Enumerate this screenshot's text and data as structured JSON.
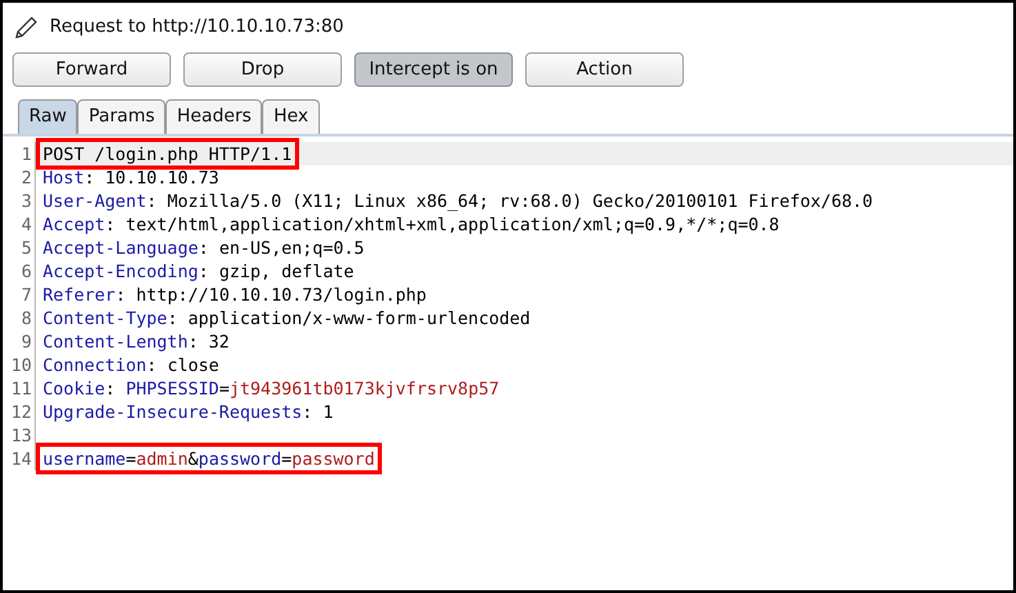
{
  "title": "Request to http://10.10.10.73:80",
  "buttons": [
    {
      "label": "Forward",
      "pressed": false
    },
    {
      "label": "Drop",
      "pressed": false
    },
    {
      "label": "Intercept is on",
      "pressed": true
    },
    {
      "label": "Action",
      "pressed": false
    }
  ],
  "tabs": [
    {
      "label": "Raw",
      "selected": true
    },
    {
      "label": "Params",
      "selected": false
    },
    {
      "label": "Headers",
      "selected": false
    },
    {
      "label": "Hex",
      "selected": false
    }
  ],
  "lines": [
    {
      "number": "1",
      "current": true,
      "highlighted": true,
      "segments": [
        {
          "kind": "plain",
          "text": "POST /login.php HTTP/1.1"
        }
      ]
    },
    {
      "number": "2",
      "current": false,
      "highlighted": false,
      "segments": [
        {
          "kind": "name",
          "text": "Host"
        },
        {
          "kind": "plain",
          "text": ": 10.10.10.73"
        }
      ]
    },
    {
      "number": "3",
      "current": false,
      "highlighted": false,
      "segments": [
        {
          "kind": "name",
          "text": "User-Agent"
        },
        {
          "kind": "plain",
          "text": ": Mozilla/5.0 (X11; Linux x86_64; rv:68.0) Gecko/20100101 Firefox/68.0"
        }
      ]
    },
    {
      "number": "4",
      "current": false,
      "highlighted": false,
      "segments": [
        {
          "kind": "name",
          "text": "Accept"
        },
        {
          "kind": "plain",
          "text": ": text/html,application/xhtml+xml,application/xml;q=0.9,*/*;q=0.8"
        }
      ]
    },
    {
      "number": "5",
      "current": false,
      "highlighted": false,
      "segments": [
        {
          "kind": "name",
          "text": "Accept-Language"
        },
        {
          "kind": "plain",
          "text": ": en-US,en;q=0.5"
        }
      ]
    },
    {
      "number": "6",
      "current": false,
      "highlighted": false,
      "segments": [
        {
          "kind": "name",
          "text": "Accept-Encoding"
        },
        {
          "kind": "plain",
          "text": ": gzip, deflate"
        }
      ]
    },
    {
      "number": "7",
      "current": false,
      "highlighted": false,
      "segments": [
        {
          "kind": "name",
          "text": "Referer"
        },
        {
          "kind": "plain",
          "text": ": http://10.10.10.73/login.php"
        }
      ]
    },
    {
      "number": "8",
      "current": false,
      "highlighted": false,
      "segments": [
        {
          "kind": "name",
          "text": "Content-Type"
        },
        {
          "kind": "plain",
          "text": ": application/x-www-form-urlencoded"
        }
      ]
    },
    {
      "number": "9",
      "current": false,
      "highlighted": false,
      "segments": [
        {
          "kind": "name",
          "text": "Content-Length"
        },
        {
          "kind": "plain",
          "text": ": 32"
        }
      ]
    },
    {
      "number": "10",
      "current": false,
      "highlighted": false,
      "segments": [
        {
          "kind": "name",
          "text": "Connection"
        },
        {
          "kind": "plain",
          "text": ": close"
        }
      ]
    },
    {
      "number": "11",
      "current": false,
      "highlighted": false,
      "segments": [
        {
          "kind": "name",
          "text": "Cookie"
        },
        {
          "kind": "plain",
          "text": ": "
        },
        {
          "kind": "name",
          "text": "PHPSESSID"
        },
        {
          "kind": "plain",
          "text": "="
        },
        {
          "kind": "value",
          "text": "jt943961tb0173kjvfrsrv8p57"
        }
      ]
    },
    {
      "number": "12",
      "current": false,
      "highlighted": false,
      "segments": [
        {
          "kind": "name",
          "text": "Upgrade-Insecure-Requests"
        },
        {
          "kind": "plain",
          "text": ": 1"
        }
      ]
    },
    {
      "number": "13"
    },
    {
      "number": "14",
      "current": false,
      "highlighted": true,
      "segments": [
        {
          "kind": "name",
          "text": "username"
        },
        {
          "kind": "plain",
          "text": "="
        },
        {
          "kind": "value",
          "text": "admin"
        },
        {
          "kind": "plain",
          "text": "&"
        },
        {
          "kind": "name",
          "text": "password"
        },
        {
          "kind": "plain",
          "text": "="
        },
        {
          "kind": "value",
          "text": "password"
        }
      ]
    }
  ]
}
